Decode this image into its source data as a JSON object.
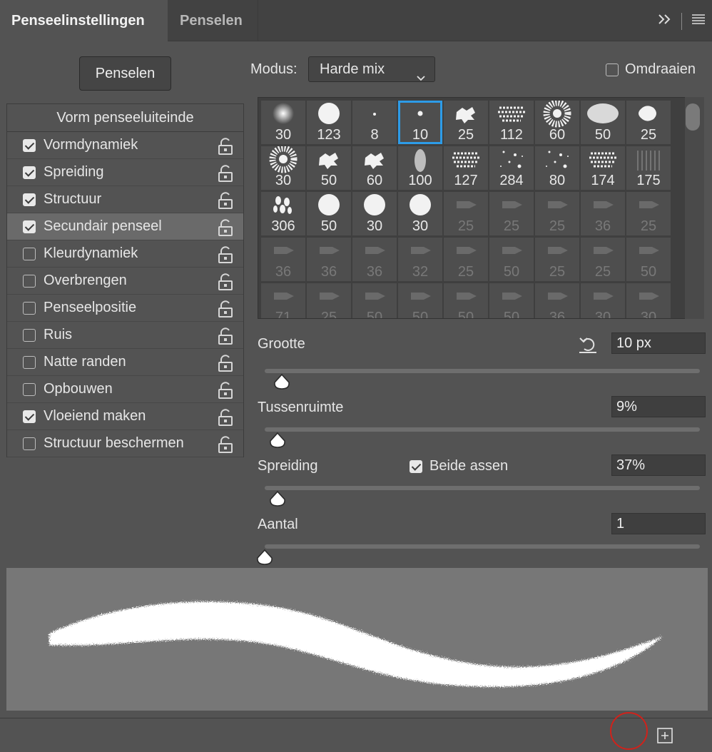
{
  "tabs": [
    {
      "label": "Penseelinstellingen",
      "active": true
    },
    {
      "label": "Penselen",
      "active": false
    }
  ],
  "brushes_button": "Penselen",
  "mode": {
    "label": "Modus:",
    "value": "Harde mix"
  },
  "flip": {
    "label": "Omdraaien",
    "checked": false
  },
  "list": {
    "header": "Vorm penseeluiteinde",
    "items": [
      {
        "label": "Vormdynamiek",
        "checked": true,
        "selected": false
      },
      {
        "label": "Spreiding",
        "checked": true,
        "selected": false
      },
      {
        "label": "Structuur",
        "checked": true,
        "selected": false
      },
      {
        "label": "Secundair penseel",
        "checked": true,
        "selected": true
      },
      {
        "label": "Kleurdynamiek",
        "checked": false,
        "selected": false
      },
      {
        "label": "Overbrengen",
        "checked": false,
        "selected": false
      },
      {
        "label": "Penseelpositie",
        "checked": false,
        "selected": false
      },
      {
        "label": "Ruis",
        "checked": false,
        "selected": false
      },
      {
        "label": "Natte randen",
        "checked": false,
        "selected": false
      },
      {
        "label": "Opbouwen",
        "checked": false,
        "selected": false
      },
      {
        "label": "Vloeiend maken",
        "checked": true,
        "selected": false
      },
      {
        "label": "Structuur beschermen",
        "checked": false,
        "selected": false
      }
    ]
  },
  "presets": [
    {
      "size": "30",
      "shape": "soft"
    },
    {
      "size": "123",
      "shape": "hard"
    },
    {
      "size": "8",
      "shape": "tiny"
    },
    {
      "size": "10",
      "shape": "dot",
      "selected": true
    },
    {
      "size": "25",
      "shape": "splat"
    },
    {
      "size": "112",
      "shape": "chalk"
    },
    {
      "size": "60",
      "shape": "speckle"
    },
    {
      "size": "50",
      "shape": "spray"
    },
    {
      "size": "25",
      "shape": "blob"
    },
    {
      "size": "30",
      "shape": "speckle"
    },
    {
      "size": "50",
      "shape": "splat"
    },
    {
      "size": "60",
      "shape": "splat"
    },
    {
      "size": "100",
      "shape": "oval"
    },
    {
      "size": "127",
      "shape": "chalk"
    },
    {
      "size": "284",
      "shape": "dots"
    },
    {
      "size": "80",
      "shape": "dots"
    },
    {
      "size": "174",
      "shape": "chalk"
    },
    {
      "size": "175",
      "shape": "hatch"
    },
    {
      "size": "306",
      "shape": "leaves"
    },
    {
      "size": "50",
      "shape": "hard"
    },
    {
      "size": "30",
      "shape": "hard"
    },
    {
      "size": "30",
      "shape": "hard"
    },
    {
      "size": "25",
      "shape": "tool",
      "dim": true
    },
    {
      "size": "25",
      "shape": "tool",
      "dim": true
    },
    {
      "size": "25",
      "shape": "tool",
      "dim": true
    },
    {
      "size": "36",
      "shape": "tool",
      "dim": true
    },
    {
      "size": "25",
      "shape": "tool",
      "dim": true
    },
    {
      "size": "36",
      "shape": "tool",
      "dim": true
    },
    {
      "size": "36",
      "shape": "tool",
      "dim": true
    },
    {
      "size": "36",
      "shape": "tool",
      "dim": true
    },
    {
      "size": "32",
      "shape": "tool",
      "dim": true
    },
    {
      "size": "25",
      "shape": "tool",
      "dim": true
    },
    {
      "size": "50",
      "shape": "tool",
      "dim": true
    },
    {
      "size": "25",
      "shape": "tool",
      "dim": true
    },
    {
      "size": "25",
      "shape": "tool",
      "dim": true
    },
    {
      "size": "50",
      "shape": "tool",
      "dim": true
    },
    {
      "size": "71",
      "shape": "tool",
      "dim": true
    },
    {
      "size": "25",
      "shape": "tool",
      "dim": true
    },
    {
      "size": "50",
      "shape": "tool",
      "dim": true
    },
    {
      "size": "50",
      "shape": "tool",
      "dim": true
    },
    {
      "size": "50",
      "shape": "tool",
      "dim": true
    },
    {
      "size": "50",
      "shape": "tool",
      "dim": true
    },
    {
      "size": "36",
      "shape": "tool",
      "dim": true
    },
    {
      "size": "30",
      "shape": "tool",
      "dim": true
    },
    {
      "size": "30",
      "shape": "tool",
      "dim": true
    }
  ],
  "params": {
    "size": {
      "label": "Grootte",
      "value": "10 px",
      "slider": 0.04
    },
    "spacing": {
      "label": "Tussenruimte",
      "value": "9%",
      "slider": 0.03
    },
    "scatter": {
      "label": "Spreiding",
      "value": "37%",
      "slider": 0.03,
      "both_axes": {
        "label": "Beide assen",
        "checked": true
      }
    },
    "count": {
      "label": "Aantal",
      "value": "1",
      "slider": 0.0
    }
  },
  "colors": {
    "accent": "#2d9ce8",
    "annotation": "#d0221b"
  }
}
